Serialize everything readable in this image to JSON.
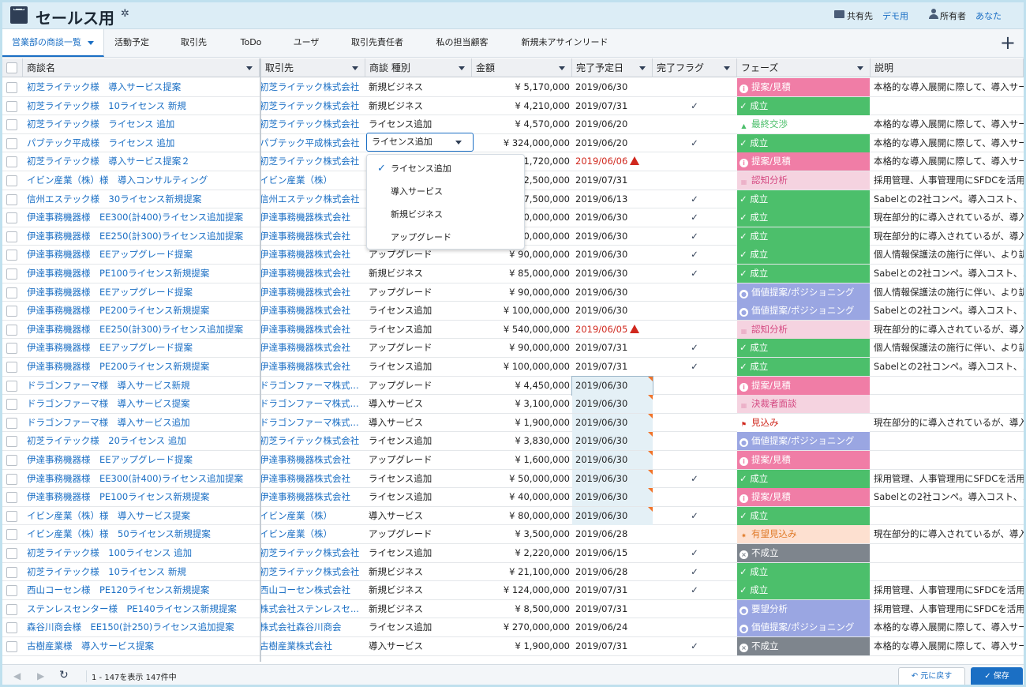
{
  "header": {
    "title": "セールス用",
    "share_label": "共有先",
    "share_value": "デモ用",
    "owner_label": "所有者",
    "owner_value": "あなた"
  },
  "tabs": [
    {
      "label": "営業部の商談一覧"
    },
    {
      "label": "活動予定"
    },
    {
      "label": "取引先"
    },
    {
      "label": "ToDo"
    },
    {
      "label": "ユーザ"
    },
    {
      "label": "取引先責任者"
    },
    {
      "label": "私の担当顧客"
    },
    {
      "label": "新規未アサインリード"
    }
  ],
  "columns": [
    "商談名",
    "取引先",
    "商談 種別",
    "金額",
    "完了予定日",
    "完了フラグ",
    "フェーズ",
    "説明"
  ],
  "type_field": {
    "value": "ライセンス追加"
  },
  "type_menu": [
    "ライセンス追加",
    "導入サービス",
    "新規ビジネス",
    "アップグレード"
  ],
  "colors": {
    "link": "#1b6fc4",
    "pink": "#f07da6",
    "green": "#4cbf6b",
    "purple": "#9aa6e2",
    "gray": "#7e858d"
  },
  "rows": [
    {
      "name": "初芝ライテック様　導入サービス提案",
      "account": "初芝ライテック株式会社",
      "type": "新規ビジネス",
      "amount": "¥ 5,170,000",
      "date": "2019/06/30",
      "flag": "",
      "phase": "提案/見積",
      "phase_style": "pink",
      "desc": "本格的な導入展開に際して、導入サー"
    },
    {
      "name": "初芝ライテック様　10ライセンス 新規",
      "account": "初芝ライテック株式会社",
      "type": "新規ビジネス",
      "amount": "¥ 4,210,000",
      "date": "2019/07/31",
      "flag": "✓",
      "phase": "成立",
      "phase_style": "green",
      "desc": ""
    },
    {
      "name": "初芝ライテック様　ライセンス 追加",
      "account": "初芝ライテック株式会社",
      "type": "ライセンス追加",
      "amount": "¥ 4,570,000",
      "date": "2019/06/20",
      "flag": "",
      "phase": "最終交渉",
      "phase_style": "white",
      "desc": "本格的な導入展開に際して、導入サー"
    },
    {
      "name": "パブテック平成様　ライセンス 追加",
      "account": "パブテック平成株式会社",
      "type": "",
      "amount": "¥ 324,000,000",
      "date": "2019/06/20",
      "flag": "✓",
      "phase": "成立",
      "phase_style": "green",
      "desc": "本格的な導入展開に際して、導入サー"
    },
    {
      "name": "初芝ライテック様　導入サービス提案２",
      "account": "初芝ライテック株式会社",
      "type": "",
      "amount": "¥ 1,720,000",
      "date": "2019/06/06",
      "flag": "",
      "phase": "提案/見積",
      "phase_style": "pink",
      "desc": "本格的な導入展開に際して、導入サー",
      "date_red": true
    },
    {
      "name": "イビン産業（株）様　導入コンサルティング",
      "account": "イビン産業（株）",
      "type": "",
      "amount": "¥ 2,500,000",
      "date": "2019/07/31",
      "flag": "",
      "phase": "認知分析",
      "phase_style": "light",
      "desc": "採用管理、人事管理用にSFDCを活用"
    },
    {
      "name": "信州エステック様　30ライセンス新規提案",
      "account": "信州エステック株式会社",
      "type": "",
      "amount": "¥ 7,500,000",
      "date": "2019/06/13",
      "flag": "✓",
      "phase": "成立",
      "phase_style": "green",
      "desc": "Sabelとの2社コンペ。導入コスト、メ"
    },
    {
      "name": "伊達事務機器様　EE300(計400)ライセンス追加提案",
      "account": "伊達事務機器株式会社",
      "type": "",
      "amount": "¥ 40,000,000",
      "date": "2019/06/30",
      "flag": "✓",
      "phase": "成立",
      "phase_style": "green",
      "desc": "現在部分的に導入されているが、導入"
    },
    {
      "name": "伊達事務機器様　EE250(計300)ライセンス追加提案",
      "account": "伊達事務機器株式会社",
      "type": "",
      "amount": "¥ 30,000,000",
      "date": "2019/06/30",
      "flag": "✓",
      "phase": "成立",
      "phase_style": "green",
      "desc": "現在部分的に導入されているが、導入"
    },
    {
      "name": "伊達事務機器様　EEアップグレード提案",
      "account": "伊達事務機器株式会社",
      "type": "アップグレード",
      "amount": "¥ 90,000,000",
      "date": "2019/06/30",
      "flag": "✓",
      "phase": "成立",
      "phase_style": "green",
      "desc": "個人情報保護法の施行に伴い、より訓"
    },
    {
      "name": "伊達事務機器様　PE100ライセンス新規提案",
      "account": "伊達事務機器株式会社",
      "type": "新規ビジネス",
      "amount": "¥ 85,000,000",
      "date": "2019/06/30",
      "flag": "✓",
      "phase": "成立",
      "phase_style": "green",
      "desc": "Sabelとの2社コンペ。導入コスト、メ"
    },
    {
      "name": "伊達事務機器様　EEアップグレード提案",
      "account": "伊達事務機器株式会社",
      "type": "アップグレード",
      "amount": "¥ 90,000,000",
      "date": "2019/06/30",
      "flag": "",
      "phase": "価値提案/ポジショニング",
      "phase_style": "purple",
      "desc": "個人情報保護法の施行に伴い、より訓"
    },
    {
      "name": "伊達事務機器様　PE200ライセンス新規提案",
      "account": "伊達事務機器株式会社",
      "type": "ライセンス追加",
      "amount": "¥ 100,000,000",
      "date": "2019/06/30",
      "flag": "",
      "phase": "価値提案/ポジショニング",
      "phase_style": "purple",
      "desc": "Sabelとの2社コンペ。導入コスト、メ"
    },
    {
      "name": "伊達事務機器様　EE250(計300)ライセンス追加提案",
      "account": "伊達事務機器株式会社",
      "type": "ライセンス追加",
      "amount": "¥ 540,000,000",
      "date": "2019/06/05",
      "flag": "",
      "phase": "認知分析",
      "phase_style": "light",
      "desc": "現在部分的に導入されているが、導入",
      "date_red": true
    },
    {
      "name": "伊達事務機器様　EEアップグレード提案",
      "account": "伊達事務機器株式会社",
      "type": "アップグレード",
      "amount": "¥ 90,000,000",
      "date": "2019/07/31",
      "flag": "✓",
      "phase": "成立",
      "phase_style": "green",
      "desc": "個人情報保護法の施行に伴い、より訓"
    },
    {
      "name": "伊達事務機器様　PE200ライセンス新規提案",
      "account": "伊達事務機器株式会社",
      "type": "ライセンス追加",
      "amount": "¥ 100,000,000",
      "date": "2019/07/31",
      "flag": "✓",
      "phase": "成立",
      "phase_style": "green",
      "desc": "Sabelとの2社コンペ。導入コスト、メ"
    },
    {
      "name": "ドラゴンファーマ様　導入サービス新規",
      "account": "ドラゴンファーマ株式...",
      "type": "アップグレード",
      "amount": "¥ 4,450,000",
      "date": "2019/06/30",
      "flag": "",
      "phase": "提案/見積",
      "phase_style": "pink",
      "desc": "",
      "date_edit": true,
      "date_first": true
    },
    {
      "name": "ドラゴンファーマ様　導入サービス提案",
      "account": "ドラゴンファーマ株式...",
      "type": "導入サービス",
      "amount": "¥ 3,100,000",
      "date": "2019/06/30",
      "flag": "",
      "phase": "決裁者面談",
      "phase_style": "light",
      "desc": "",
      "date_edit": true
    },
    {
      "name": "ドラゴンファーマ様　導入サービス追加",
      "account": "ドラゴンファーマ株式...",
      "type": "導入サービス",
      "amount": "¥ 1,900,000",
      "date": "2019/06/30",
      "flag": "",
      "phase": "見込み",
      "phase_style": "white-red",
      "desc": "現在部分的に導入されているが、導入",
      "date_edit": true
    },
    {
      "name": "初芝ライテック様　20ライセンス 追加",
      "account": "初芝ライテック株式会社",
      "type": "ライセンス追加",
      "amount": "¥ 3,830,000",
      "date": "2019/06/30",
      "flag": "",
      "phase": "価値提案/ポジショニング",
      "phase_style": "purple",
      "desc": "",
      "date_edit": true
    },
    {
      "name": "伊達事務機器様　EEアップグレード提案",
      "account": "伊達事務機器株式会社",
      "type": "アップグレード",
      "amount": "¥ 1,600,000",
      "date": "2019/06/30",
      "flag": "",
      "phase": "提案/見積",
      "phase_style": "pink",
      "desc": "",
      "date_edit": true
    },
    {
      "name": "伊達事務機器様　EE300(計400)ライセンス追加提案",
      "account": "伊達事務機器株式会社",
      "type": "ライセンス追加",
      "amount": "¥ 50,000,000",
      "date": "2019/06/30",
      "flag": "✓",
      "phase": "成立",
      "phase_style": "green",
      "desc": "採用管理、人事管理用にSFDCを活用",
      "date_edit": true
    },
    {
      "name": "伊達事務機器様　PE100ライセンス新規提案",
      "account": "伊達事務機器株式会社",
      "type": "ライセンス追加",
      "amount": "¥ 40,000,000",
      "date": "2019/06/30",
      "flag": "",
      "phase": "提案/見積",
      "phase_style": "pink",
      "desc": "Sabelとの2社コンペ。導入コスト、メ",
      "date_edit": true
    },
    {
      "name": "イビン産業（株）様　導入サービス提案",
      "account": "イビン産業（株）",
      "type": "導入サービス",
      "amount": "¥ 80,000,000",
      "date": "2019/06/30",
      "flag": "✓",
      "phase": "成立",
      "phase_style": "green",
      "desc": "",
      "date_edit": true
    },
    {
      "name": "イビン産業（株）様　50ライセンス新規提案",
      "account": "イビン産業（株）",
      "type": "アップグレード",
      "amount": "¥ 3,500,000",
      "date": "2019/06/28",
      "flag": "",
      "phase": "有望見込み",
      "phase_style": "peach",
      "desc": "現在部分的に導入されているが、導入"
    },
    {
      "name": "初芝ライテック様　100ライセンス 追加",
      "account": "初芝ライテック株式会社",
      "type": "ライセンス追加",
      "amount": "¥ 2,220,000",
      "date": "2019/06/15",
      "flag": "✓",
      "phase": "不成立",
      "phase_style": "gray",
      "desc": ""
    },
    {
      "name": "初芝ライテック様　10ライセンス 新規",
      "account": "初芝ライテック株式会社",
      "type": "新規ビジネス",
      "amount": "¥ 21,100,000",
      "date": "2019/06/28",
      "flag": "✓",
      "phase": "成立",
      "phase_style": "green",
      "desc": ""
    },
    {
      "name": "西山コーセン様　PE120ライセンス新規提案",
      "account": "西山コーセン株式会社",
      "type": "新規ビジネス",
      "amount": "¥ 124,000,000",
      "date": "2019/07/31",
      "flag": "✓",
      "phase": "成立",
      "phase_style": "green",
      "desc": "採用管理、人事管理用にSFDCを活用"
    },
    {
      "name": "ステンレスセンター様　PE140ライセンス新規提案",
      "account": "株式会社ステンレスセ...",
      "type": "新規ビジネス",
      "amount": "¥ 8,500,000",
      "date": "2019/07/31",
      "flag": "",
      "phase": "要望分析",
      "phase_style": "purple",
      "desc": "採用管理、人事管理用にSFDCを活用"
    },
    {
      "name": "森谷川商会様　EE150(計250)ライセンス追加提案",
      "account": "株式会社森谷川商会",
      "type": "ライセンス追加",
      "amount": "¥ 270,000,000",
      "date": "2019/06/24",
      "flag": "",
      "phase": "価値提案/ポジショニング",
      "phase_style": "purple",
      "desc": "本格的な導入展開に際して、導入サー"
    },
    {
      "name": "古樹産業様　導入サービス提案",
      "account": "古樹産業株式会社",
      "type": "導入サービス",
      "amount": "¥ 1,900,000",
      "date": "2019/07/31",
      "flag": "✓",
      "phase": "不成立",
      "phase_style": "gray",
      "desc": "本格的な導入展開に際して、導入サー"
    }
  ],
  "footer": {
    "count_text": "1 - 147を表示 147件中",
    "revert_label": "元に戻す",
    "save_label": "保存"
  }
}
